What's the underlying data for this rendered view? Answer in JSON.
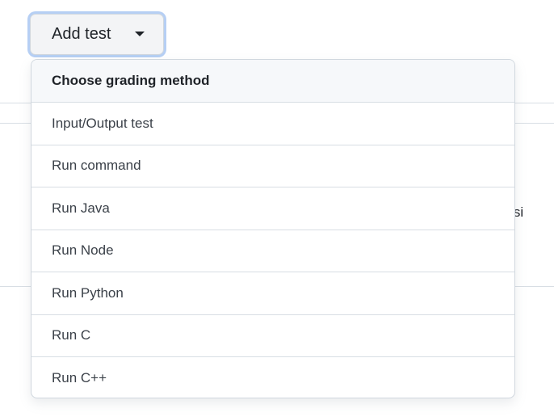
{
  "background": {
    "partial_text": "bmissi"
  },
  "add_button": {
    "label": "Add test",
    "caret_icon": "caret-down-icon"
  },
  "menu": {
    "header": "Choose grading method",
    "items": [
      {
        "label": "Input/Output test"
      },
      {
        "label": "Run command"
      },
      {
        "label": "Run Java"
      },
      {
        "label": "Run Node"
      },
      {
        "label": "Run Python"
      },
      {
        "label": "Run C"
      },
      {
        "label": "Run C++"
      }
    ]
  },
  "colors": {
    "button_focus_ring": "#b6cff4",
    "button_bg": "#f3f4f6",
    "menu_header_bg": "#f6f8fa",
    "divider": "#d8dee4"
  }
}
